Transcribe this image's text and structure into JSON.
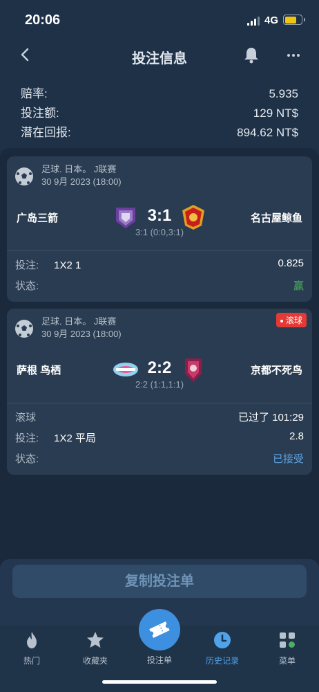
{
  "status": {
    "time": "20:06",
    "network": "4G"
  },
  "header": {
    "title": "投注信息"
  },
  "summary": [
    {
      "label": "赔率:",
      "value": "5.935"
    },
    {
      "label": "投注额:",
      "value": "129 NT$"
    },
    {
      "label": "潜在回报:",
      "value": "894.62 NT$"
    }
  ],
  "bets": [
    {
      "league": "足球. 日本。 J联赛",
      "date": "30 9月 2023 (18:00)",
      "home": "广岛三箭",
      "away": "名古屋鲸鱼",
      "score": "3:1",
      "halves": "3:1 (0:0,3:1)",
      "bet_label": "投注:",
      "selection": "1X2 1",
      "odds": "0.825",
      "status_label": "状态:",
      "status": "赢"
    },
    {
      "live_tag": "滚球",
      "league": "足球. 日本。 J联赛",
      "date": "30 9月 2023 (18:00)",
      "home": "萨根 鸟栖",
      "away": "京都不死鸟",
      "score": "2:2",
      "halves": "2:2 (1:1,1:1)",
      "live_label": "滚球",
      "elapsed": "已过了 101:29",
      "bet_label": "投注:",
      "selection": "1X2 平局",
      "odds": "2.8",
      "status_label": "状态:",
      "status": "已接受"
    }
  ],
  "copy_button": "复制投注单",
  "tabs": [
    {
      "label": "热门",
      "icon": "fire-icon"
    },
    {
      "label": "收藏夹",
      "icon": "star-icon"
    },
    {
      "label": "投注单",
      "icon": "ticket-icon"
    },
    {
      "label": "历史记录",
      "icon": "clock-icon"
    },
    {
      "label": "菜单",
      "icon": "grid-icon"
    }
  ],
  "colors": {
    "win": "#4cb061",
    "accepted": "#5ea6e6",
    "live": "#e53935",
    "active_tab": "#4fa3ea"
  }
}
